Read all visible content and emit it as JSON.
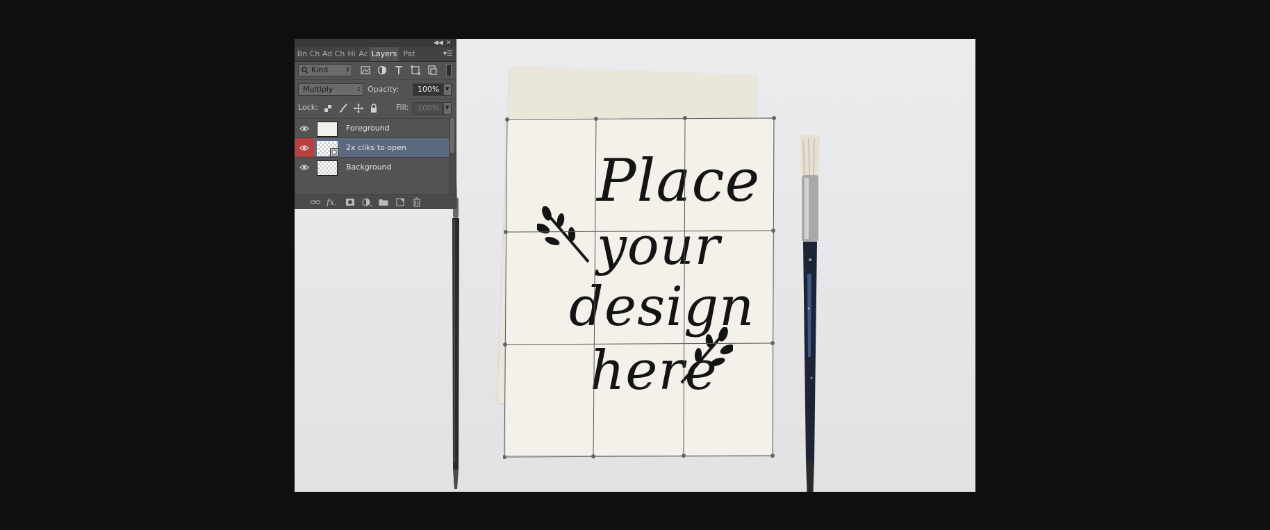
{
  "panel": {
    "tabs": [
      {
        "label": "Bn"
      },
      {
        "label": "Ch"
      },
      {
        "label": "Ad"
      },
      {
        "label": "Ch"
      },
      {
        "label": "Hi"
      },
      {
        "label": "Ac"
      },
      {
        "label": "Layers"
      },
      {
        "label": "Pat"
      }
    ],
    "filter": {
      "label": "Kind"
    },
    "blend_mode": "Multiply",
    "opacity": {
      "label": "Opacity:",
      "value": "100%"
    },
    "lock": {
      "label": "Lock:"
    },
    "fill": {
      "label": "Fill:",
      "value": "100%"
    },
    "layers": [
      {
        "name": "Foreground",
        "visible": true,
        "selected": false
      },
      {
        "name": "2x cliks to open",
        "visible": true,
        "selected": true
      },
      {
        "name": "Background",
        "visible": true,
        "selected": false
      }
    ],
    "footer": {
      "fx_label": "fx."
    }
  },
  "canvas": {
    "design_text": {
      "line1": "Place",
      "line2": "your",
      "line3": "design",
      "line4": "here"
    }
  },
  "colors": {
    "panel_bg": "#535353",
    "selected_layer": "#5b6a80",
    "eye_highlight": "#b84040",
    "ink": "#141414"
  }
}
